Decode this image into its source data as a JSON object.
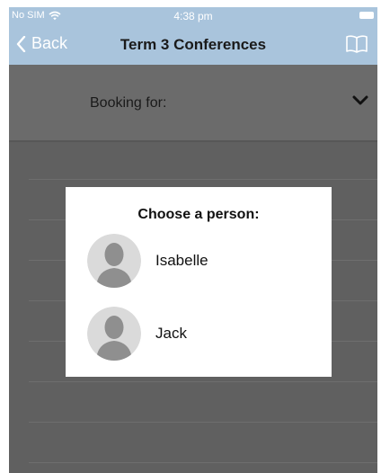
{
  "status_bar": {
    "carrier": "No SIM",
    "time": "4:38 pm"
  },
  "nav": {
    "back_label": "Back",
    "title": "Term 3 Conferences"
  },
  "booking": {
    "label": "Booking for:"
  },
  "modal": {
    "heading": "Choose a person:",
    "people": [
      {
        "name": "Isabelle"
      },
      {
        "name": "Jack"
      }
    ]
  },
  "colors": {
    "nav_bar": "#a9c4dc",
    "overlay": "#606060",
    "dialog": "#ffffff"
  },
  "icons": [
    "wifi-icon",
    "battery-icon",
    "back-chevron-icon",
    "book-icon",
    "chevron-down-icon",
    "avatar-icon"
  ]
}
